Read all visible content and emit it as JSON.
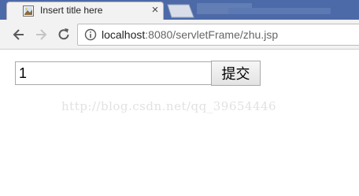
{
  "browser": {
    "tab": {
      "title": "Insert title here",
      "close_symbol": "×",
      "favicon": "page-image-icon"
    },
    "toolbar": {
      "back_icon": "arrow-left-icon",
      "forward_icon": "arrow-right-icon",
      "reload_icon": "reload-icon"
    },
    "address_bar": {
      "info_icon": "info-icon",
      "host": "localhost",
      "rest": ":8080/servletFrame/zhu.jsp"
    }
  },
  "page": {
    "input_value": "1",
    "submit_label": "提交",
    "watermark": "http://blog.csdn.net/qq_39654446"
  },
  "colors": {
    "tabstrip": "#4c6aa8",
    "toolbar": "#f2f2f2"
  }
}
